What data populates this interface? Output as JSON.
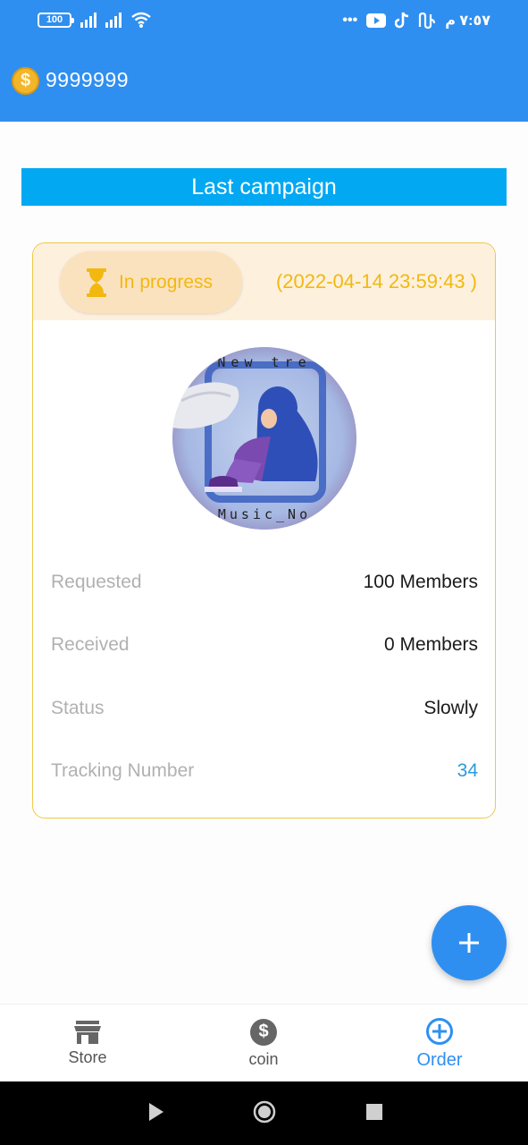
{
  "status_bar": {
    "battery": "100",
    "time": "٧:٥٧ م",
    "more": "•••",
    "notification_icons": [
      "youtube-icon",
      "tiktok-icon",
      "app-icon"
    ]
  },
  "header": {
    "coin_icon": "coin-icon",
    "coin_symbol": "$",
    "balance": "9999999"
  },
  "section": {
    "title": "Last campaign"
  },
  "campaign": {
    "status_label": "In progress",
    "status_icon": "hourglass-icon",
    "date": "(2022-04-14 23:59:43 )",
    "details": [
      {
        "label": "Requested",
        "value": "100 Members"
      },
      {
        "label": "Received",
        "value": "0 Members"
      },
      {
        "label": "Status",
        "value": "Slowly"
      },
      {
        "label": "Tracking Number",
        "value": "34"
      }
    ],
    "avatar": {
      "top_text": "New tre",
      "bottom_text": "Music_No"
    }
  },
  "fab": {
    "icon": "plus-icon",
    "symbol": "+"
  },
  "bottom_nav": {
    "items": [
      {
        "label": "Store",
        "icon": "store-icon"
      },
      {
        "label": "coin",
        "icon": "dollar-icon"
      },
      {
        "label": "Order",
        "icon": "add-circle-icon",
        "active": true
      }
    ]
  },
  "colors": {
    "primary": "#2f8ff0",
    "section_bar": "#02a8f2",
    "pending_accent": "#f2b80f",
    "card_border": "#f0c84a",
    "link": "#2b9bdc"
  }
}
